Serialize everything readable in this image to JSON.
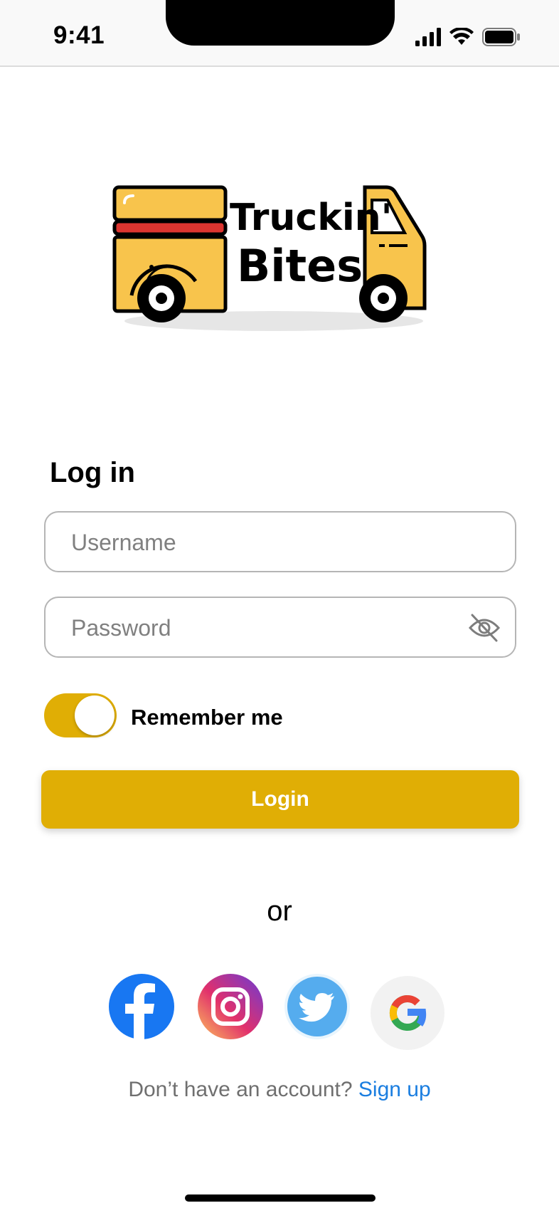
{
  "status_bar": {
    "time": "9:41"
  },
  "logo": {
    "line1": "Truckin'",
    "line2": "Bites"
  },
  "login_form": {
    "title": "Log in",
    "username_placeholder": "Username",
    "password_placeholder": "Password",
    "remember_label": "Remember me",
    "remember_on": true,
    "login_label": "Login"
  },
  "separator": "or",
  "social": [
    {
      "icon": "facebook-icon",
      "color": "#1877f2"
    },
    {
      "icon": "instagram-icon",
      "color": "#e1306c"
    },
    {
      "icon": "twitter-icon",
      "color": "#55acee"
    },
    {
      "icon": "google-icon",
      "color": "#4285f4"
    }
  ],
  "signup": {
    "prompt": "Don’t have an account?",
    "link": "Sign up"
  },
  "colors": {
    "accent": "#e0ae05",
    "link": "#1b7ee0",
    "truck_yellow": "#f8c44c",
    "truck_red": "#dc3530"
  }
}
